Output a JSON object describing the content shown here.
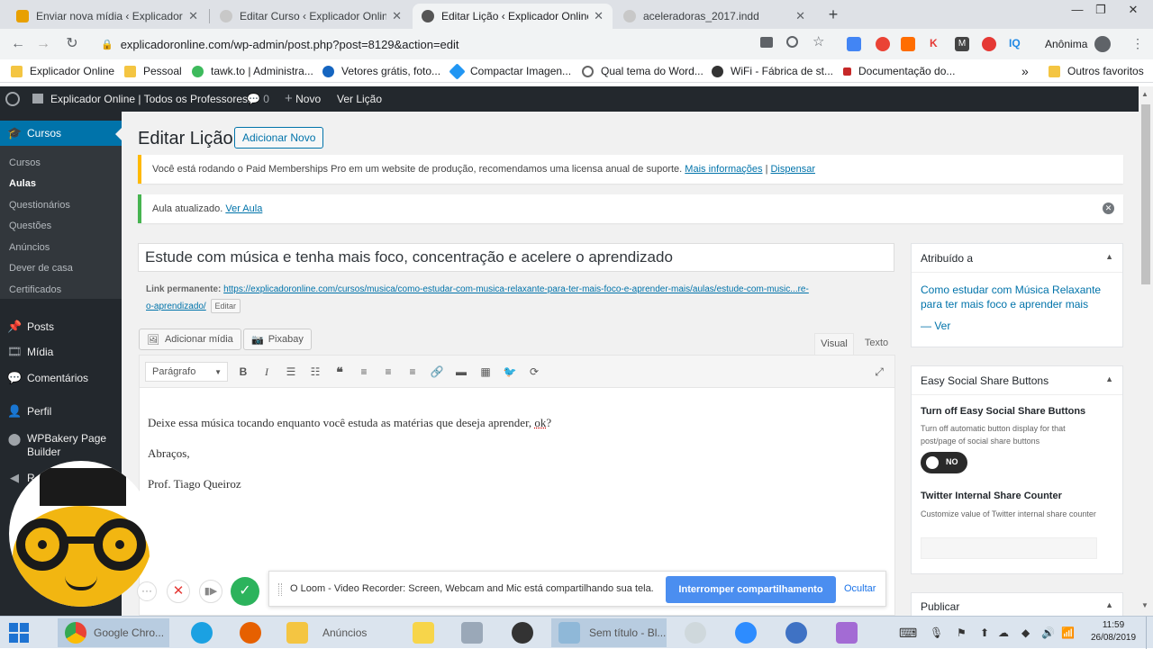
{
  "browser": {
    "tabs": [
      {
        "title": "Enviar nova mídia ‹ Explicador O",
        "active": false,
        "color": "#f0a500"
      },
      {
        "title": "Editar Curso ‹ Explicador Online |",
        "active": false,
        "color": "#d0d0d0"
      },
      {
        "title": "Editar Lição ‹ Explicador Online |",
        "active": true,
        "color": "#555555"
      },
      {
        "title": "aceleradoras_2017.indd",
        "active": false,
        "color": "#d0d0d0"
      }
    ],
    "new_tab": "+",
    "url": "explicadoronline.com/wp-admin/post.php?post=8129&action=edit",
    "profile": "Anônima",
    "bookmarks": [
      "Explicador Online",
      "Pessoal",
      "tawk.to | Administra...",
      "Vetores grátis, foto...",
      "Compactar Imagen...",
      "Qual tema do Word...",
      "WiFi - Fábrica de st...",
      "Documentação do..."
    ],
    "bookmarks_more": "»",
    "other_favorites": "Outros favoritos"
  },
  "adminbar": {
    "site": "Explicador Online | Todos os Professores...",
    "comments_count": "0",
    "new_label": "Novo",
    "view_label": "Ver Lição"
  },
  "sidebar": {
    "current": "Cursos",
    "submenu": [
      "Cursos",
      "Aulas",
      "Questionários",
      "Questões",
      "Anúncios",
      "Dever de casa",
      "Certificados"
    ],
    "menu": [
      "Posts",
      "Mídia",
      "Comentários",
      "Perfil",
      "WPBakery Page Builder",
      "R"
    ]
  },
  "page": {
    "title": "Editar Lição",
    "add_new": "Adicionar Novo",
    "notice1_text": "Você está rodando o Paid Memberships Pro em um website de produção, recomendamos uma licensa anual de suporte.",
    "notice1_link1": "Mais informações",
    "notice1_sep": "|",
    "notice1_link2": "Dispensar",
    "notice2_text": "Aula atualizado.",
    "notice2_link": "Ver Aula",
    "post_title": "Estude com música e tenha mais foco, concentração e acelere o aprendizado",
    "permalink_label": "Link permanente:",
    "permalink_url1": "https://explicadoronline.com/cursos/musica/como-estudar-com-musica-relaxante-para-ter-mais-foco-e-aprender-mais/aulas/estude-com-music...re-",
    "permalink_url2": "o-aprendizado/",
    "edit_label": "Editar",
    "add_media": "Adicionar mídia",
    "pixabay": "Pixabay",
    "tab_visual": "Visual",
    "tab_text": "Texto",
    "format_select": "Parágrafo",
    "content_line1": "Deixe essa música tocando enquanto você estuda as matérias que deseja aprender, ",
    "content_line1_underlined": "ok",
    "content_line1_end": "?",
    "content_line2": "Abraços,",
    "content_line3": "Prof. Tiago Queiroz"
  },
  "side_boxes": {
    "assigned_title": "Atribuído a",
    "assigned_link": "Como estudar com Música Relaxante para ter mais foco e aprender mais",
    "assigned_view": "— Ver",
    "essb_title": "Easy Social Share Buttons",
    "essb_turnoff_title": "Turn off Easy Social Share Buttons",
    "essb_turnoff_desc": "Turn off automatic button display for that post/page of social share buttons",
    "toggle_label": "NO",
    "twitter_title": "Twitter Internal Share Counter",
    "twitter_desc": "Customize value of Twitter internal share counter",
    "twitter_value": "",
    "publish_title": "Publicar"
  },
  "loom": {
    "message": "O Loom - Video Recorder: Screen, Webcam and Mic está compartilhando sua tela.",
    "stop_button": "Interromper compartilhamento",
    "hide_button": "Ocultar"
  },
  "taskbar": {
    "items": [
      "Google Chro...",
      "Anúncios",
      "Sem título - Bl..."
    ],
    "time": "11:59",
    "date": "26/08/2019"
  },
  "colors": {
    "wp_blue": "#0073aa",
    "admin_dark": "#23282d",
    "loom_blue": "#4b8ef0",
    "notice_yellow": "#ffb900",
    "notice_green": "#46b450"
  }
}
